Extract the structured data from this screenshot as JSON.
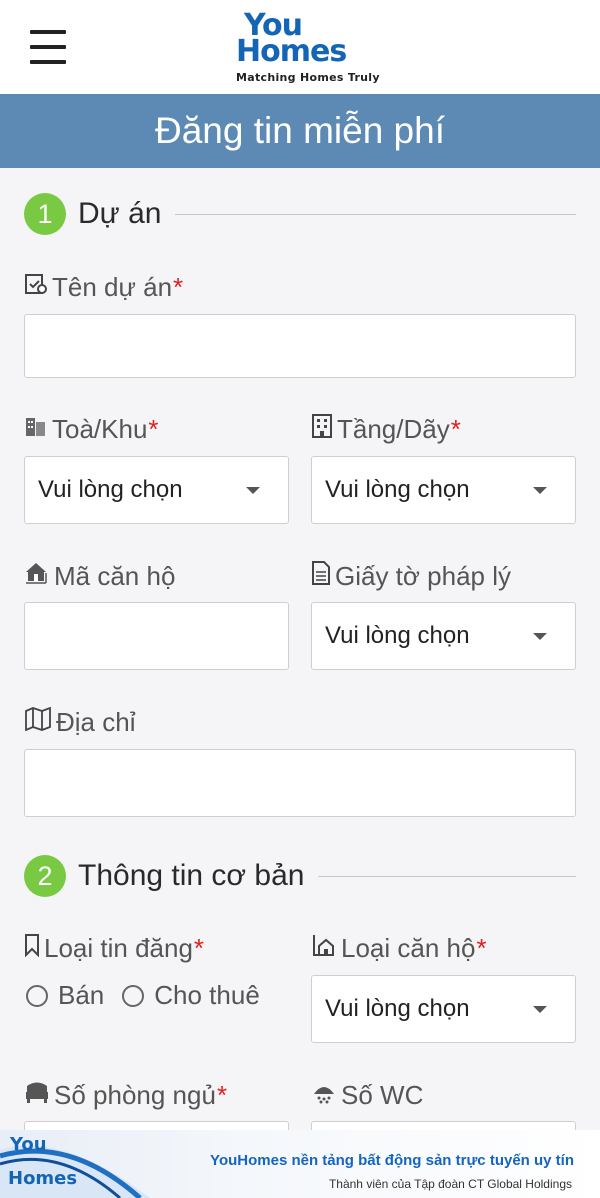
{
  "header": {
    "logo_line1": "You",
    "logo_line2": "Homes",
    "logo_tagline": "Matching Homes Truly"
  },
  "page_title": "Đăng tin miễn phí",
  "section1": {
    "step": "1",
    "title": "Dự án",
    "project_name_label": "Tên dự án",
    "building_label": "Toà/Khu",
    "building_value": "Vui lòng chọn",
    "floor_label": "Tầng/Dãy",
    "floor_value": "Vui lòng chọn",
    "apartment_code_label": "Mã căn hộ",
    "legal_docs_label": "Giấy tờ pháp lý",
    "legal_docs_value": "Vui lòng chọn",
    "address_label": "Địa chỉ"
  },
  "section2": {
    "step": "2",
    "title": "Thông tin cơ bản",
    "listing_type_label": "Loại tin đăng",
    "option_sell": "Bán",
    "option_rent": "Cho thuê",
    "apartment_type_label": "Loại căn hộ",
    "apartment_type_value": "Vui lòng chọn",
    "bedrooms_label": "Số phòng ngủ",
    "wc_label": "Số WC"
  },
  "required_mark": "*",
  "footer": {
    "logo_line1": "You",
    "logo_line2": "Homes",
    "headline": "YouHomes nền tảng bất động sản trực tuyến uy tín",
    "subline": "Thành viên của Tập đoàn CT Global Holdings"
  },
  "colors": {
    "brand_blue": "#1465b5",
    "title_bar": "#5d89b5",
    "step_green": "#7ac943",
    "required_red": "#e02020"
  }
}
